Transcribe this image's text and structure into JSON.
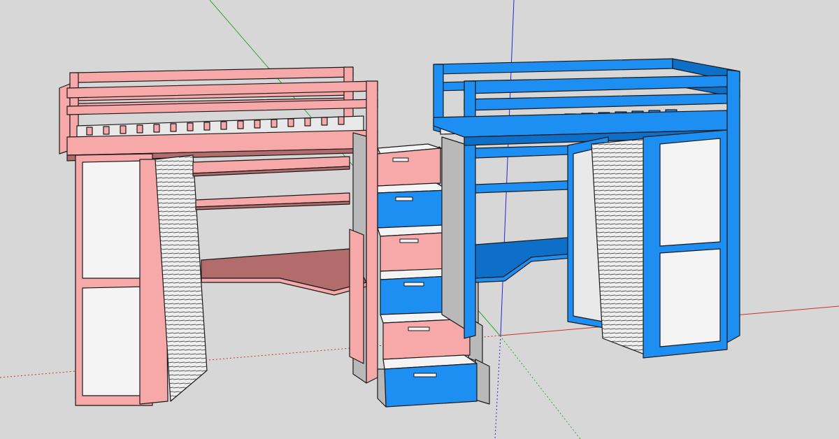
{
  "scene": {
    "colors": {
      "background": "#d7d7d7",
      "pink": "#f7a9a9",
      "pink_dark": "#b36c6c",
      "blue": "#1d8ff2",
      "blue_dark": "#0e6fc8",
      "panel": "#f4f4f4",
      "shade": "#b9b9b9",
      "stroke": "#1a1a1a",
      "axis_red": "#c83232",
      "axis_green": "#2fa82f",
      "axis_blue": "#2525d8"
    },
    "objects": [
      {
        "name": "pink-loft-bed",
        "color": "pink"
      },
      {
        "name": "staircase-drawers",
        "color": "pink-blue"
      },
      {
        "name": "blue-loft-bed",
        "color": "blue"
      }
    ]
  }
}
